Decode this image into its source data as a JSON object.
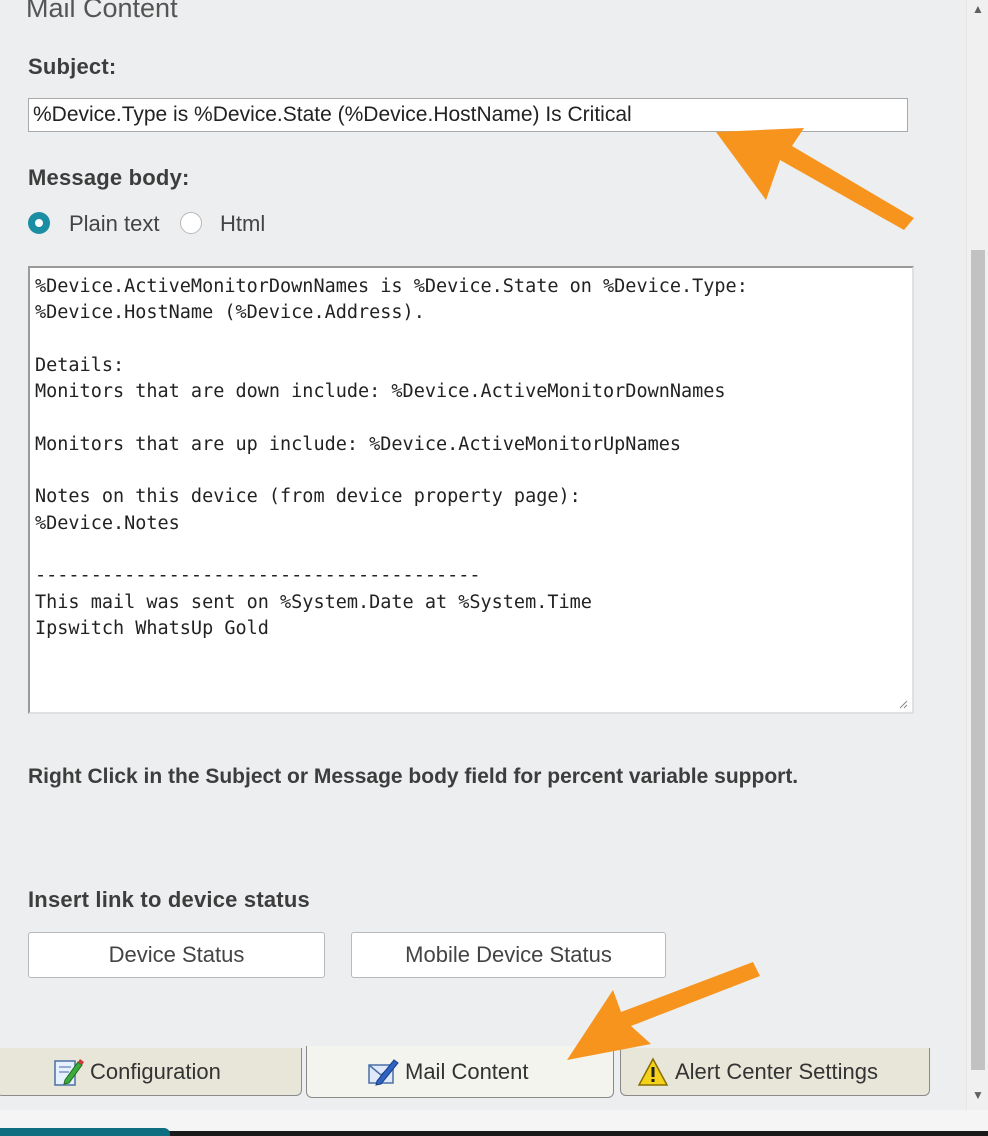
{
  "section": {
    "title": "Mail Content"
  },
  "subject": {
    "label": "Subject:",
    "value": "%Device.Type is %Device.State (%Device.HostName) Is Critical"
  },
  "message_body": {
    "label": "Message body:",
    "format_options": [
      {
        "label": "Plain text",
        "selected": true
      },
      {
        "label": "Html",
        "selected": false
      }
    ],
    "lines": [
      "%Device.ActiveMonitorDownNames is %Device.State on %Device.Type:",
      "%Device.HostName (%Device.Address).",
      "",
      "Details:",
      "Monitors that are down include: %Device.ActiveMonitorDownNames",
      "",
      "Monitors that are up include: %Device.ActiveMonitorUpNames",
      "",
      "Notes on this device (from device property page):",
      "%Device.Notes",
      "",
      "----------------------------------------",
      "This mail was sent on %System.Date at %System.Time",
      "Ipswitch WhatsUp Gold"
    ]
  },
  "hint": {
    "text": "Right Click in the Subject or Message body field for percent variable support."
  },
  "insert_link": {
    "label": "Insert link to device status",
    "buttons": {
      "device_status": "Device Status",
      "mobile_device_status": "Mobile Device Status"
    }
  },
  "tabs": [
    {
      "label": "Configuration",
      "icon": "pencil-form-icon",
      "active": false
    },
    {
      "label": "Mail Content",
      "icon": "mail-envelope-icon",
      "active": true
    },
    {
      "label": "Alert Center Settings",
      "icon": "warning-icon",
      "active": false
    }
  ],
  "colors": {
    "accent": "#1a8ea3",
    "annotation_arrow": "#f7941d"
  }
}
